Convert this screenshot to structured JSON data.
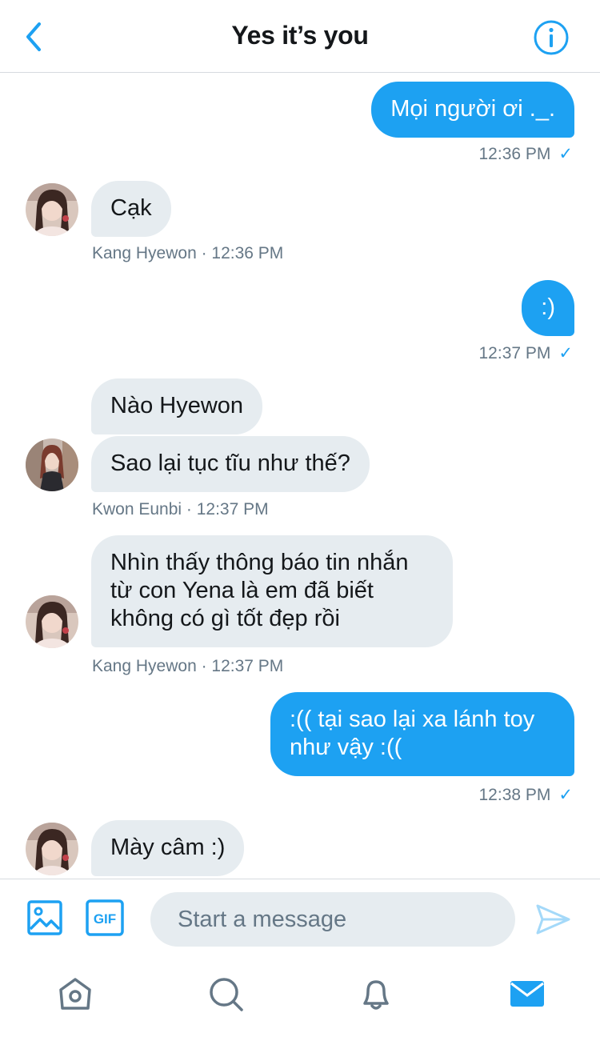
{
  "header": {
    "title": "Yes it’s you",
    "back_icon": "chevron-left-icon",
    "info_icon": "info-icon"
  },
  "colors": {
    "accent": "#1da1f2",
    "incoming_bubble": "#e6ecf0",
    "meta_text": "#657786"
  },
  "messages": [
    {
      "direction": "out",
      "text": "Mọi người ơi ._.",
      "time": "12:36 PM",
      "check": "✓"
    },
    {
      "direction": "in",
      "text": "Cạk",
      "sender_time": "Kang Hyewon · 12:36 PM"
    },
    {
      "direction": "out",
      "text": ":)",
      "time": "12:37 PM",
      "check": "✓"
    },
    {
      "direction": "in",
      "text": "Nào Hyewon"
    },
    {
      "direction": "in",
      "text": "Sao lại tục tĩu như thế?",
      "sender_time": "Kwon Eunbi · 12:37 PM"
    },
    {
      "direction": "in",
      "text": "Nhìn thấy thông báo tin nhắn\ntừ con Yena là em đã biết\nkhông có gì tốt đẹp rồi",
      "sender_time": "Kang Hyewon · 12:37 PM"
    },
    {
      "direction": "out",
      "text": ":(( tại sao lại xa lánh toy\nnhư vậy :((",
      "time": "12:38 PM",
      "check": "✓"
    },
    {
      "direction": "in",
      "text": "Mày câm :)"
    }
  ],
  "composer": {
    "placeholder": "Start a message",
    "image_icon": "image-icon",
    "gif_label": "GIF",
    "send_icon": "send-icon"
  },
  "tabbar": {
    "items": [
      "home-icon",
      "search-icon",
      "bell-icon",
      "mail-icon"
    ],
    "active": "mail-icon"
  }
}
